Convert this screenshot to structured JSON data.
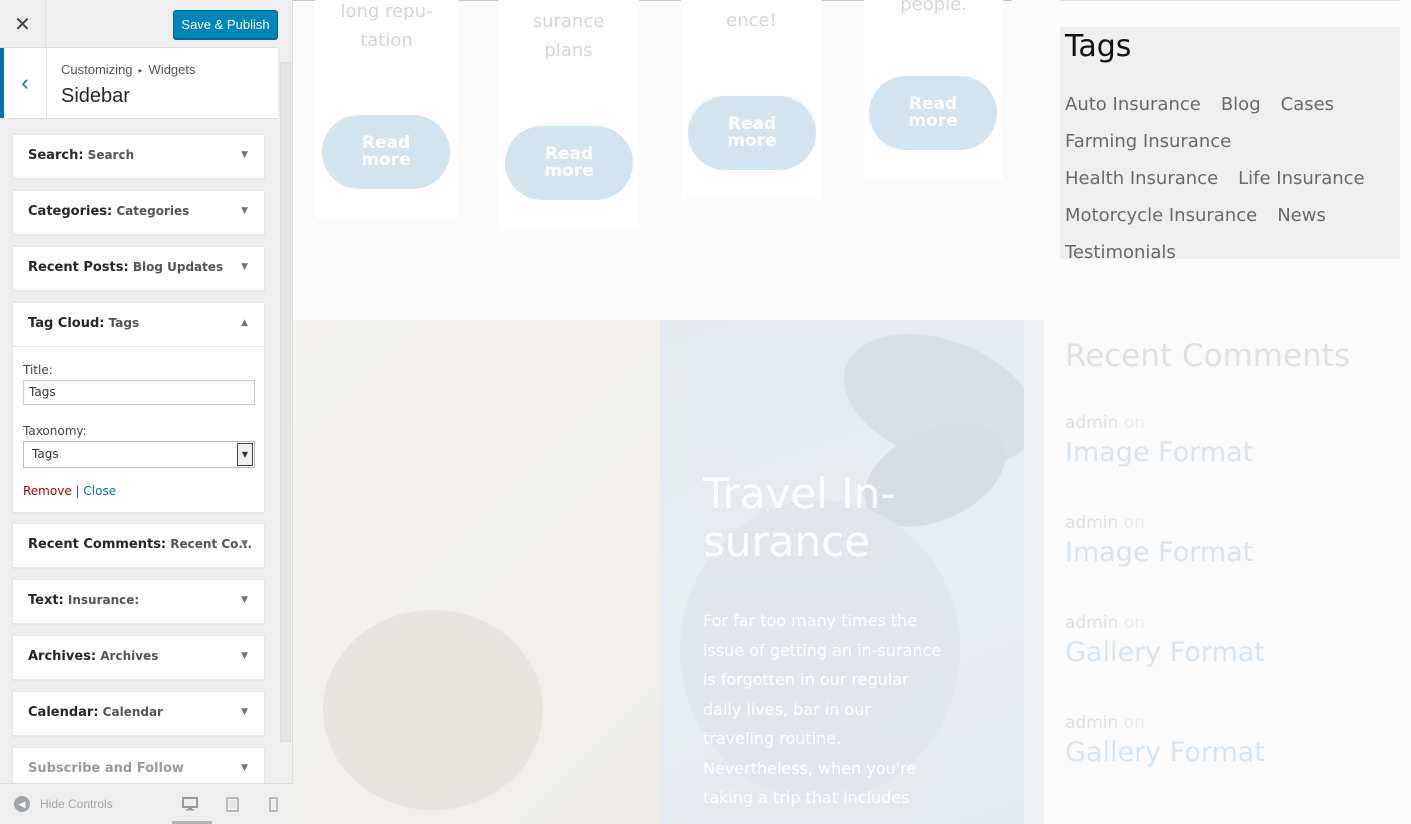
{
  "customizer": {
    "close_glyph": "✕",
    "save_label": "Save & Publish",
    "back_glyph": "‹",
    "breadcrumb_root": "Customizing",
    "breadcrumb_sep": "▸",
    "breadcrumb_current": "Widgets",
    "section_title": "Sidebar",
    "widgets": [
      {
        "type": "Search:",
        "title": "Search"
      },
      {
        "type": "Categories:",
        "title": "Categories"
      },
      {
        "type": "Recent Posts:",
        "title": "Blog Updates"
      },
      {
        "type": "Tag Cloud:",
        "title": "Tags"
      },
      {
        "type": "Recent Comments:",
        "title": "Recent Co..."
      },
      {
        "type": "Text:",
        "title": "Insurance:"
      },
      {
        "type": "Archives:",
        "title": "Archives"
      },
      {
        "type": "Calendar:",
        "title": "Calendar"
      },
      {
        "type": "Subscribe and Follow",
        "title": ""
      }
    ],
    "tag_cloud_form": {
      "title_label": "Title:",
      "title_value": "Tags",
      "taxonomy_label": "Taxonomy:",
      "taxonomy_value": "Tags",
      "remove_label": "Remove",
      "separator": "|",
      "close_label": "Close"
    },
    "footer": {
      "hide_controls_label": "Hide Controls"
    }
  },
  "preview": {
    "cards": [
      {
        "text": "long repu-\ntation",
        "button": "Read\nmore"
      },
      {
        "text": "surance\nplans",
        "button": "Read\nmore"
      },
      {
        "text": "ence!",
        "button": "Read\nmore"
      },
      {
        "text": "people.",
        "button": "Read\nmore"
      }
    ],
    "travel": {
      "title": "Travel In-\nsurance",
      "text": "For far too many times the issue of getting an in-surance is forgotten in our regular daily lives, bar in our traveling routine. Nevertheless, when you're taking a trip that includes"
    },
    "tags_widget": {
      "title": "Tags",
      "tags": [
        "Auto Insurance",
        "Blog",
        "Cases",
        "Farming Insurance",
        "Health Insurance",
        "Life Insurance",
        "Motorcycle Insurance",
        "News",
        "Testimonials"
      ]
    },
    "recent_comments": {
      "title": "Recent Comments",
      "items": [
        {
          "author": "admin",
          "on": "on",
          "post": "Image Format"
        },
        {
          "author": "admin",
          "on": "on",
          "post": "Image Format"
        },
        {
          "author": "admin",
          "on": "on",
          "post": "Gallery Format"
        },
        {
          "author": "admin",
          "on": "on",
          "post": "Gallery Format"
        }
      ]
    }
  },
  "colors": {
    "primary_button": "#0085ba",
    "accent_blue": "#0073aa",
    "remove_red": "#aa0000",
    "read_more_bg": "#d4e4ee",
    "tags_widget_bg": "#efefef"
  },
  "icons": {
    "close": "close-icon",
    "back": "chevron-left-icon",
    "collapse": "triangle-down-icon",
    "expand": "triangle-up-icon",
    "hide_controls": "collapse-circle-icon",
    "desktop": "desktop-icon",
    "tablet": "tablet-icon",
    "mobile": "mobile-icon"
  }
}
